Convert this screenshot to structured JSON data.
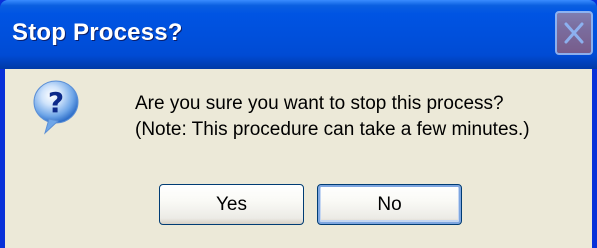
{
  "window": {
    "title": "Stop Process?",
    "close_icon": "close-icon"
  },
  "message": {
    "icon": "question-icon",
    "line1": "Are you sure you want to stop this process?",
    "line2": "(Note: This procedure can take a few minutes.)"
  },
  "buttons": {
    "yes_label": "Yes",
    "no_label": "No"
  },
  "colors": {
    "titlebar": "#0054e3",
    "frame": "#0831d9",
    "client": "#ece9d8",
    "focus_ring": "#7ea6e0"
  }
}
